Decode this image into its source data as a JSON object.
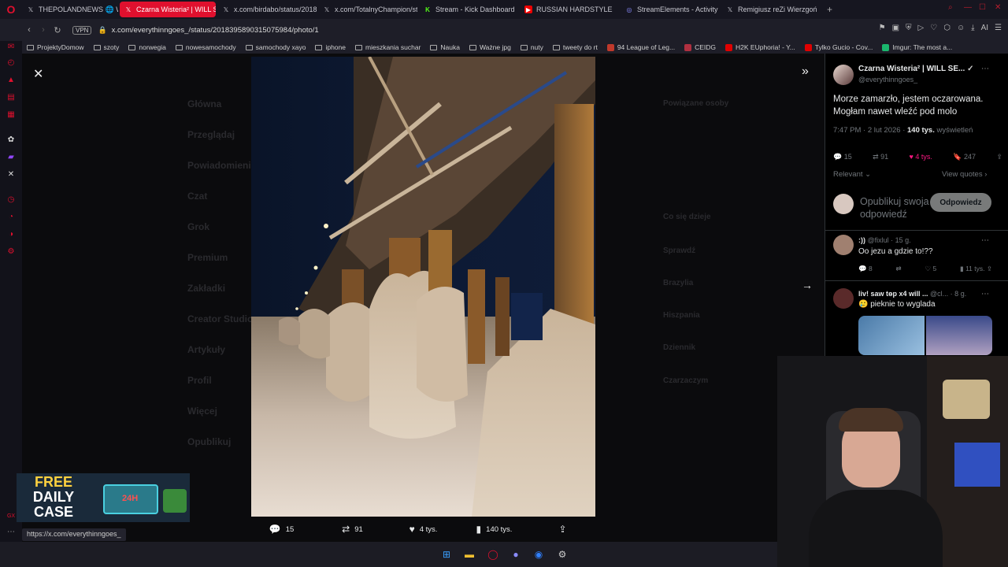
{
  "browser": {
    "tabs": [
      {
        "title": "THEPOLANDNEWS 🌐 W SIE",
        "icon": "x-icon"
      },
      {
        "title": "Czarna Wisteria² | WILL SE",
        "icon": "x-icon",
        "active": true
      },
      {
        "title": "x.com/birdabo/status/2018",
        "icon": "x-icon"
      },
      {
        "title": "x.com/TotalnyChampion/st",
        "icon": "x-icon"
      },
      {
        "title": "Stream - Kick Dashboard",
        "icon": "kick-icon"
      },
      {
        "title": "RUSSIAN HARDSTYLE",
        "icon": "youtube-icon"
      },
      {
        "title": "StreamElements - Activity",
        "icon": "streamelements-icon"
      },
      {
        "title": "Remigiusz reZi Wierzgoń",
        "icon": "x-icon"
      }
    ],
    "new_tab": "+",
    "vpn_label": "VPN",
    "url": "x.com/everythinngoes_/status/2018395890315075984/photo/1",
    "ai_label": "AI",
    "bookmarks": [
      {
        "label": "ProjektyDomow",
        "type": "folder"
      },
      {
        "label": "szoty",
        "type": "folder"
      },
      {
        "label": "norwegia",
        "type": "folder"
      },
      {
        "label": "nowesamochody",
        "type": "folder"
      },
      {
        "label": "samochody xayo",
        "type": "folder"
      },
      {
        "label": "iphone",
        "type": "folder"
      },
      {
        "label": "mieszkania suchar",
        "type": "folder"
      },
      {
        "label": "Nauka",
        "type": "folder"
      },
      {
        "label": "Ważne jpg",
        "type": "folder"
      },
      {
        "label": "nuty",
        "type": "folder"
      },
      {
        "label": "tweety do rt",
        "type": "folder"
      },
      {
        "label": "94 League of Leg...",
        "type": "site",
        "color": "#c0392b"
      },
      {
        "label": "CEIDG",
        "type": "site",
        "color": "#b03040"
      },
      {
        "label": "H2K EUphoria! - Y...",
        "type": "site",
        "color": "#e00000"
      },
      {
        "label": "Tylko Gucio - Cov...",
        "type": "site",
        "color": "#e00000"
      },
      {
        "label": "Imgur: The most a...",
        "type": "site",
        "color": "#1bb76e"
      }
    ]
  },
  "viewer": {
    "ghost_nav": [
      "Główna",
      "Przeglądaj",
      "Powiadomienia",
      "Czat",
      "Grok",
      "Premium",
      "Zakładki",
      "Creator Studio",
      "Artykuły",
      "Profil",
      "Więcej",
      "Opublikuj"
    ],
    "ghost_right": [
      "Powiązane osoby",
      "Co się dzieje",
      "Sprawdź",
      "Brazylia",
      "Hiszpania",
      "Dziennik",
      "Czarzaczym"
    ],
    "actions": {
      "replies": "15",
      "reposts": "91",
      "likes": "4 tys.",
      "views": "140 tys."
    }
  },
  "promo": {
    "line1": "FREE",
    "line2": "DAILY",
    "line3": "CASE",
    "badge": "24H"
  },
  "tweet": {
    "author_name": "Czarna Wisteria² | WILL SE...",
    "handle": "@everythinngoes_",
    "text": "Morze zamarzło, jestem oczarowana. Mogłam nawet wleźć pod molo",
    "time": "7:47 PM · 2 lut 2026 · ",
    "views_count": "140 tys.",
    "views_label": " wyświetleń",
    "replies": "15",
    "reposts": "91",
    "likes": "4 tys.",
    "bookmarks": "247",
    "sort": "Relevant ⌄",
    "view_quotes": "View quotes ›",
    "reply_placeholder": "Opublikuj swoja odpowiedź",
    "reply_button": "Odpowiedz"
  },
  "comments": [
    {
      "name": ":))",
      "handle": "@fixlul · 15 g.",
      "text": "Oo jezu a gdzie to!??",
      "replies": "8",
      "reposts": "",
      "likes": "5",
      "views": "11 tys."
    },
    {
      "name": "liv! saw tөp x4 will ...",
      "handle": "@cl... · 8 g.",
      "text": "🥲 pieknie to wyglada"
    }
  ],
  "status_url": "https://x.com/everythinngoes_"
}
